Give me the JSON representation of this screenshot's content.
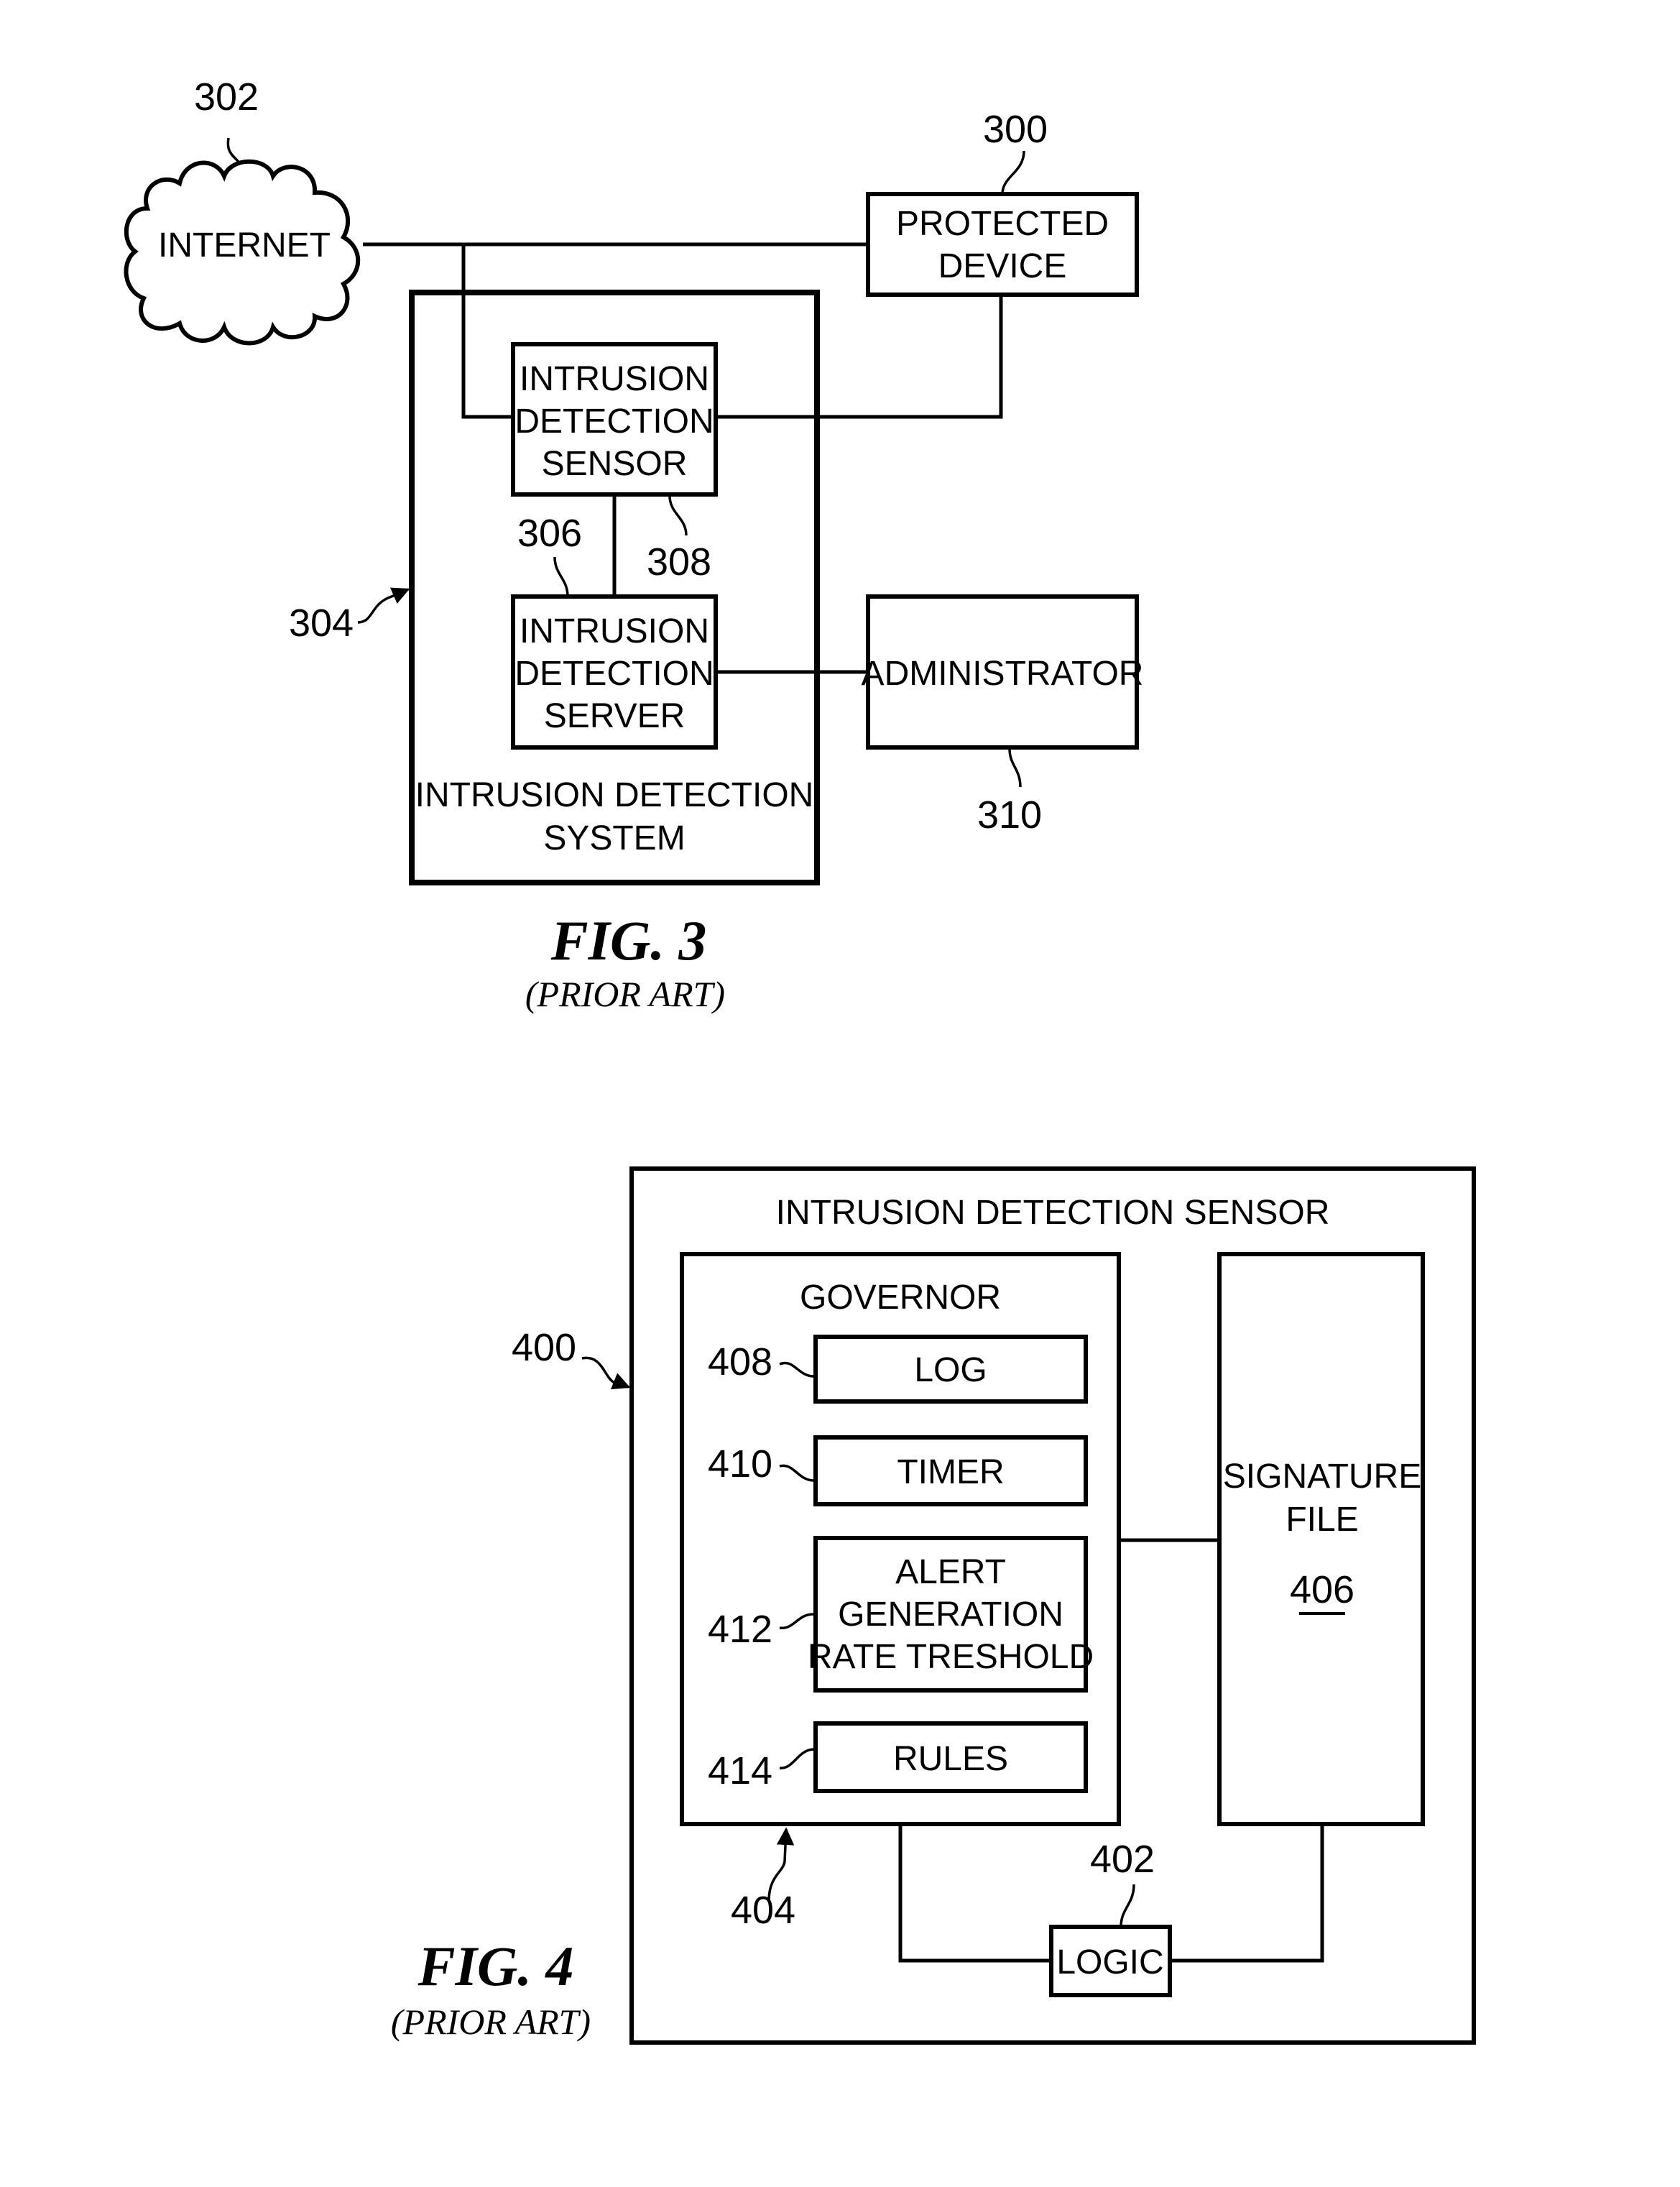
{
  "fig3": {
    "caption": "FIG. 3",
    "subcaption": "(PRIOR ART)",
    "internet": {
      "ref": "302",
      "label": "INTERNET",
      "icon": "cloud-icon"
    },
    "protected_device": {
      "ref": "300",
      "lines": [
        "PROTECTED",
        "DEVICE"
      ]
    },
    "ids_system": {
      "ref": "304",
      "lines": [
        "INTRUSION DETECTION",
        "SYSTEM"
      ]
    },
    "sensor": {
      "ref": "308",
      "lines": [
        "INTRUSION",
        "DETECTION",
        "SENSOR"
      ]
    },
    "server": {
      "ref": "306",
      "lines": [
        "INTRUSION",
        "DETECTION",
        "SERVER"
      ]
    },
    "administrator": {
      "ref": "310",
      "label": "ADMINISTRATOR"
    }
  },
  "fig4": {
    "caption": "FIG. 4",
    "subcaption": "(PRIOR ART)",
    "sensor": {
      "ref": "400",
      "title": "INTRUSION DETECTION SENSOR"
    },
    "governor": {
      "ref": "404",
      "title": "GOVERNOR",
      "items": [
        {
          "ref": "408",
          "lines": [
            "LOG"
          ]
        },
        {
          "ref": "410",
          "lines": [
            "TIMER"
          ]
        },
        {
          "ref": "412",
          "lines": [
            "ALERT",
            "GENERATION",
            "RATE TRESHOLD"
          ]
        },
        {
          "ref": "414",
          "lines": [
            "RULES"
          ]
        }
      ]
    },
    "signature_file": {
      "ref": "406",
      "lines": [
        "SIGNATURE",
        "FILE"
      ]
    },
    "logic": {
      "ref": "402",
      "label": "LOGIC"
    }
  }
}
